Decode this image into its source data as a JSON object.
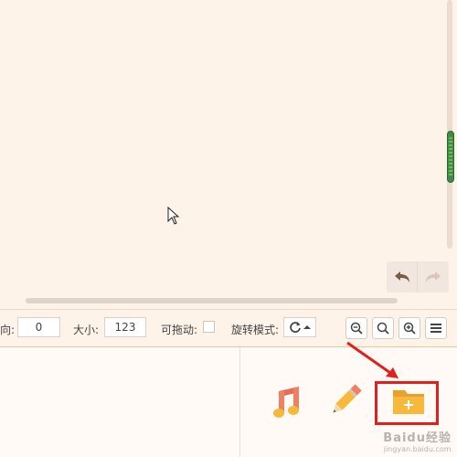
{
  "toolbar": {
    "direction_label": "向:",
    "direction_value": "0",
    "size_label": "大小:",
    "size_value": "123",
    "draggable_label": "可拖动:",
    "draggable_checked": false,
    "rotate_mode_label": "旋转模式:"
  },
  "icons": {
    "undo": "undo-icon",
    "redo": "redo-icon",
    "zoom_out": "zoom-out-icon",
    "zoom_reset": "zoom-reset-icon",
    "zoom_in": "zoom-in-icon",
    "menu": "menu-icon",
    "rotate": "rotate-icon",
    "music": "music-icon",
    "pencil": "pencil-icon",
    "new_folder": "new-folder-icon"
  },
  "watermark": {
    "line1": "Baidu经验",
    "line2": "jingyan.baidu.com"
  },
  "colors": {
    "background": "#fdf3e9",
    "scroll_thumb": "#3f8a45",
    "highlight": "#e0201c",
    "folder": "#f6b93b"
  }
}
